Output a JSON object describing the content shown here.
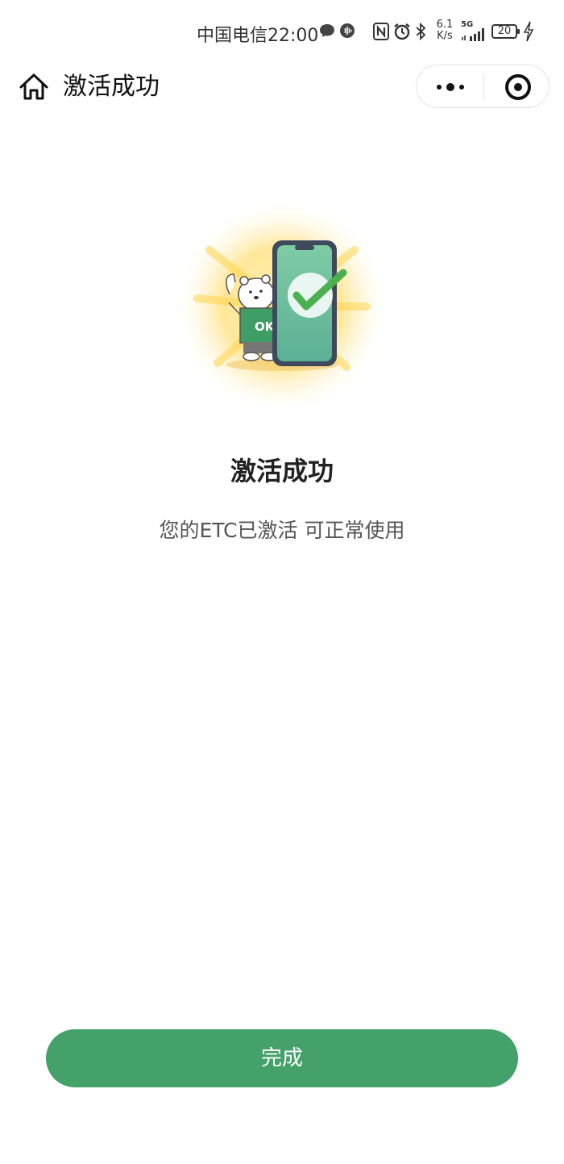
{
  "status_bar": {
    "carrier": "中国电信",
    "time": "22:00",
    "net_speed_value": "6.1",
    "net_speed_unit": "K/s",
    "signal_label": "5G",
    "battery": "20",
    "icons": [
      "message-icon",
      "voice-icon",
      "nfc-icon",
      "alarm-icon",
      "bluetooth-icon",
      "signal-icon",
      "charging-icon"
    ]
  },
  "nav": {
    "title": "激活成功",
    "icons": [
      "home-icon",
      "more-icon",
      "close-target-icon"
    ]
  },
  "illustration": {
    "badge_text": "OK",
    "colors": {
      "phone": "#6bbf9a",
      "check": "#4caf50",
      "glow": "#ffe58f"
    }
  },
  "result": {
    "title": "激活成功",
    "subtitle": "您的ETC已激活 可正常使用"
  },
  "actions": {
    "done_label": "完成",
    "accent": "#44a16a"
  }
}
